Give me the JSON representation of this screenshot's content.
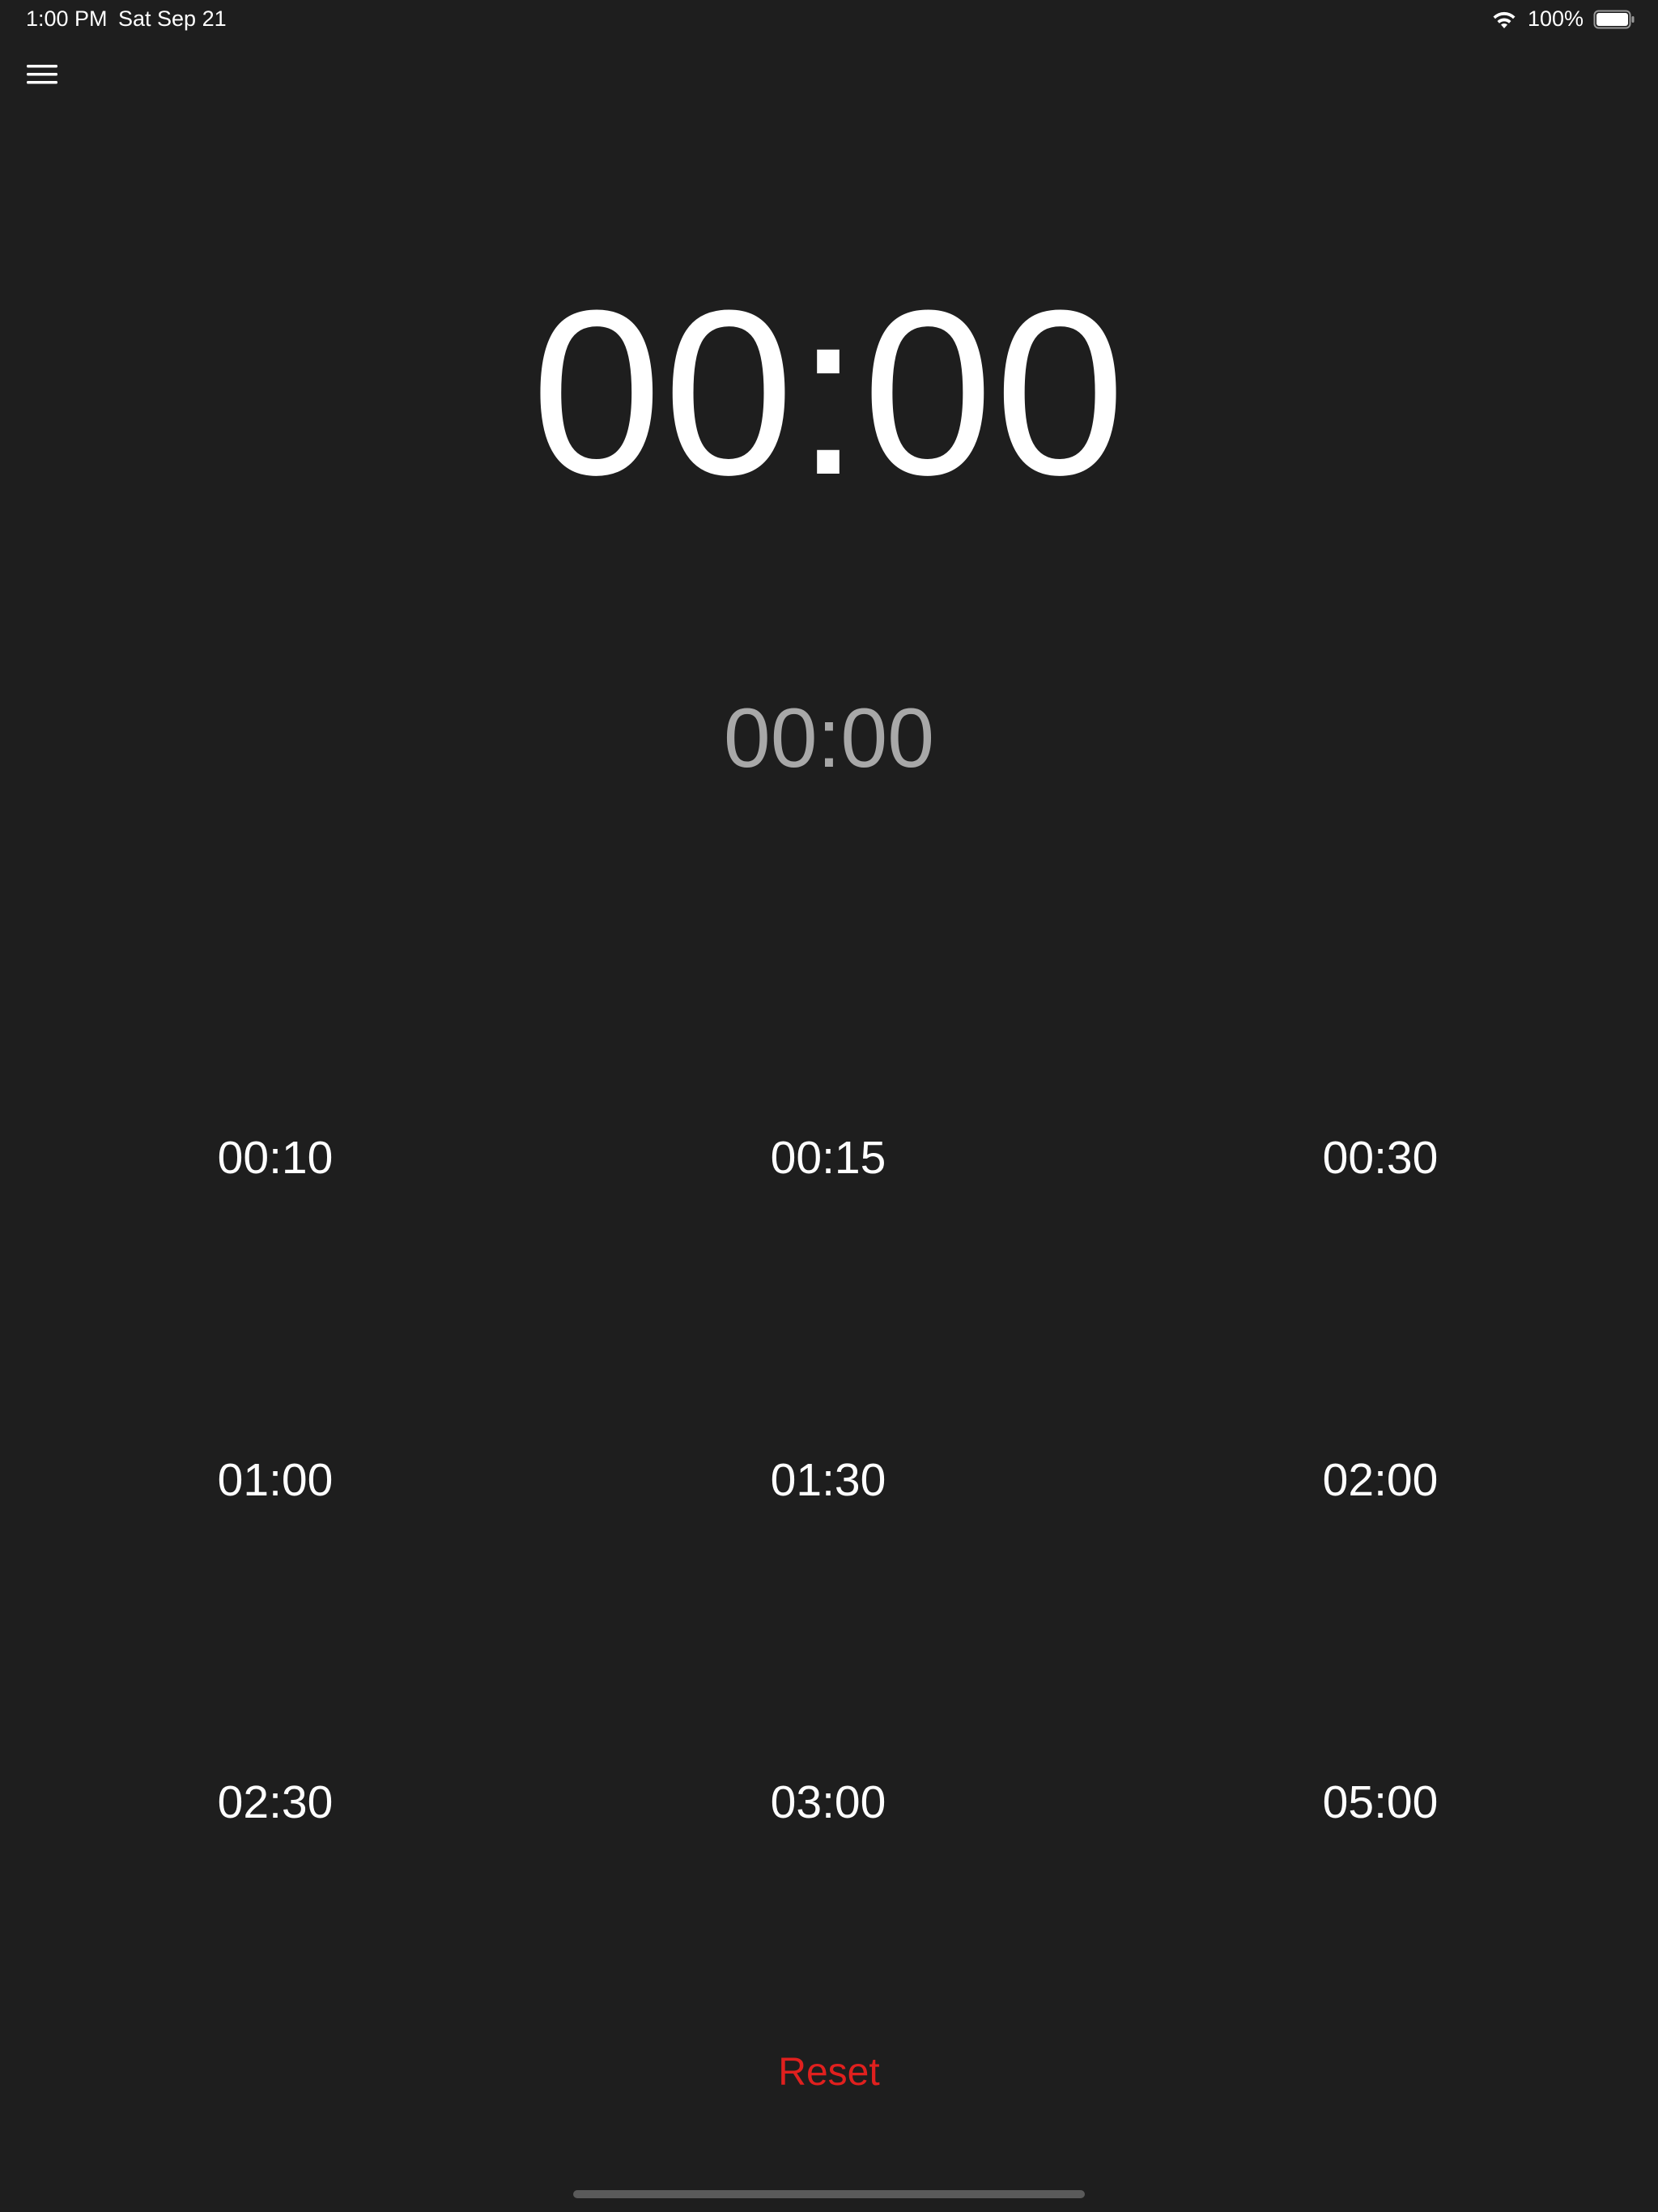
{
  "status_bar": {
    "time": "1:00 PM",
    "date": "Sat Sep 21",
    "battery_percent": "100%",
    "wifi_icon": "wifi-icon",
    "battery_icon": "battery-full-icon"
  },
  "menu": {
    "icon": "hamburger-menu-icon"
  },
  "timer": {
    "main": "00:00",
    "secondary": "00:00"
  },
  "presets": [
    "00:10",
    "00:15",
    "00:30",
    "01:00",
    "01:30",
    "02:00",
    "02:30",
    "03:00",
    "05:00"
  ],
  "reset_label": "Reset",
  "colors": {
    "background": "#1e1e1e",
    "primary_text": "#ffffff",
    "secondary_text": "#a8a8a8",
    "reset_accent": "#e0201e"
  }
}
